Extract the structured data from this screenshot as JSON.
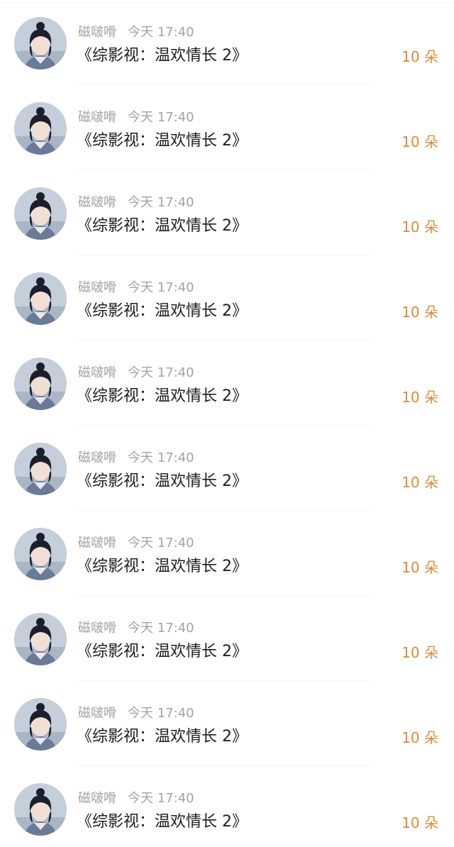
{
  "items": [
    {
      "sender": "磁啵嗗",
      "time": "今天 17:40",
      "title": "《综影视：温欢情长 2》",
      "amount": "10 朵"
    },
    {
      "sender": "磁啵嗗",
      "time": "今天 17:40",
      "title": "《综影视：温欢情长 2》",
      "amount": "10 朵"
    },
    {
      "sender": "磁啵嗗",
      "time": "今天 17:40",
      "title": "《综影视：温欢情长 2》",
      "amount": "10 朵"
    },
    {
      "sender": "磁啵嗗",
      "time": "今天 17:40",
      "title": "《综影视：温欢情长 2》",
      "amount": "10 朵"
    },
    {
      "sender": "磁啵嗗",
      "time": "今天 17:40",
      "title": "《综影视：温欢情长 2》",
      "amount": "10 朵"
    },
    {
      "sender": "磁啵嗗",
      "time": "今天 17:40",
      "title": "《综影视：温欢情长 2》",
      "amount": "10 朵"
    },
    {
      "sender": "磁啵嗗",
      "time": "今天 17:40",
      "title": "《综影视：温欢情长 2》",
      "amount": "10 朵"
    },
    {
      "sender": "磁啵嗗",
      "time": "今天 17:40",
      "title": "《综影视：温欢情长 2》",
      "amount": "10 朵"
    },
    {
      "sender": "磁啵嗗",
      "time": "今天 17:40",
      "title": "《综影视：温欢情长 2》",
      "amount": "10 朵"
    },
    {
      "sender": "磁啵嗗",
      "time": "今天 17:40",
      "title": "《综影视：温欢情长 2》",
      "amount": "10 朵"
    }
  ],
  "colors": {
    "amount": "#e0893a",
    "meta": "#a3a3a3",
    "title": "#1e1e1e"
  },
  "icons": {
    "avatar": "avatar-photo"
  }
}
